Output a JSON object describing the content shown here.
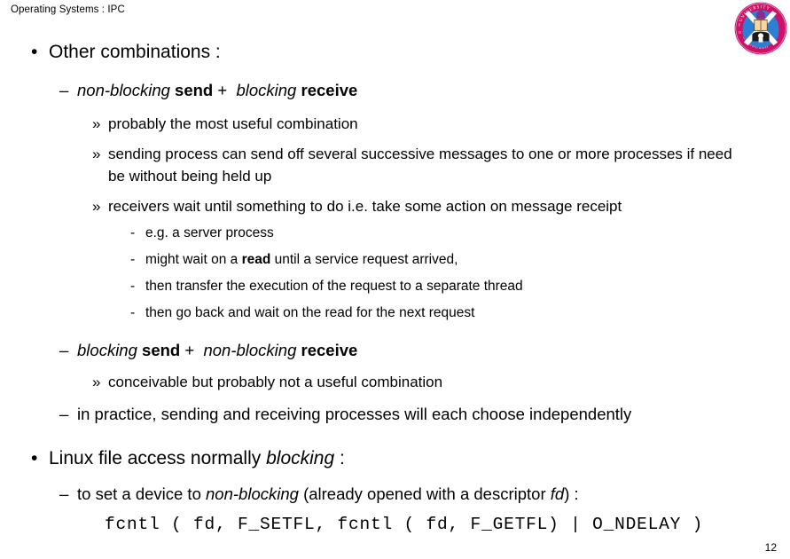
{
  "header": {
    "title": "Operating Systems : IPC"
  },
  "logo": {
    "name": "university-of-edinburgh-crest",
    "ring_color": "#CC1166",
    "shield_color": "#2D7FD4",
    "saltire_color": "#FFFFFF",
    "ring_text": "UNIVERSITY OF EDINBURGH"
  },
  "markers": {
    "bullet": "•",
    "dash": "–",
    "guillemet": "»",
    "hyphen": "-"
  },
  "body": {
    "b1_other_combinations": "Other combinations :",
    "b1_1_pre": "non-blocking",
    "b1_1_send": "send",
    "b1_1_plus": "+",
    "b1_1_mid": "blocking",
    "b1_1_receive": "receive",
    "b1_1_a": "probably the most useful combination",
    "b1_1_b": "sending process can send off several successive messages to one or more processes if need be without being held up",
    "b1_1_c": "receivers wait until something to do i.e. take some action on message receipt",
    "b1_1_c_i": "e.g. a server process",
    "b1_1_c_ii_pre": "might wait on a",
    "b1_1_c_ii_bold": "read",
    "b1_1_c_ii_post": "until a service request arrived,",
    "b1_1_c_iii": "then transfer the execution of the request to a separate thread",
    "b1_1_c_iv": "then go back and wait on the read for the next request",
    "b1_2_pre": "blocking",
    "b1_2_send": "send",
    "b1_2_plus": "+",
    "b1_2_mid": "non-blocking",
    "b1_2_receive": "receive",
    "b1_2_a": "conceivable but probably not a useful combination",
    "b1_3": "in practice, sending and receiving processes will each choose independently",
    "b2_pre": "Linux file access normally",
    "b2_italic": "blocking",
    "b2_post": ":",
    "b2_1_pre": "to set a device to",
    "b2_1_italic": "non-blocking",
    "b2_1_mid": "(already opened with a descriptor",
    "b2_1_italic2": "fd",
    "b2_1_post": ") :",
    "code": "fcntl ( fd, F_SETFL, fcntl ( fd, F_GETFL) | O_NDELAY )"
  },
  "footer": {
    "page_number": "12"
  }
}
